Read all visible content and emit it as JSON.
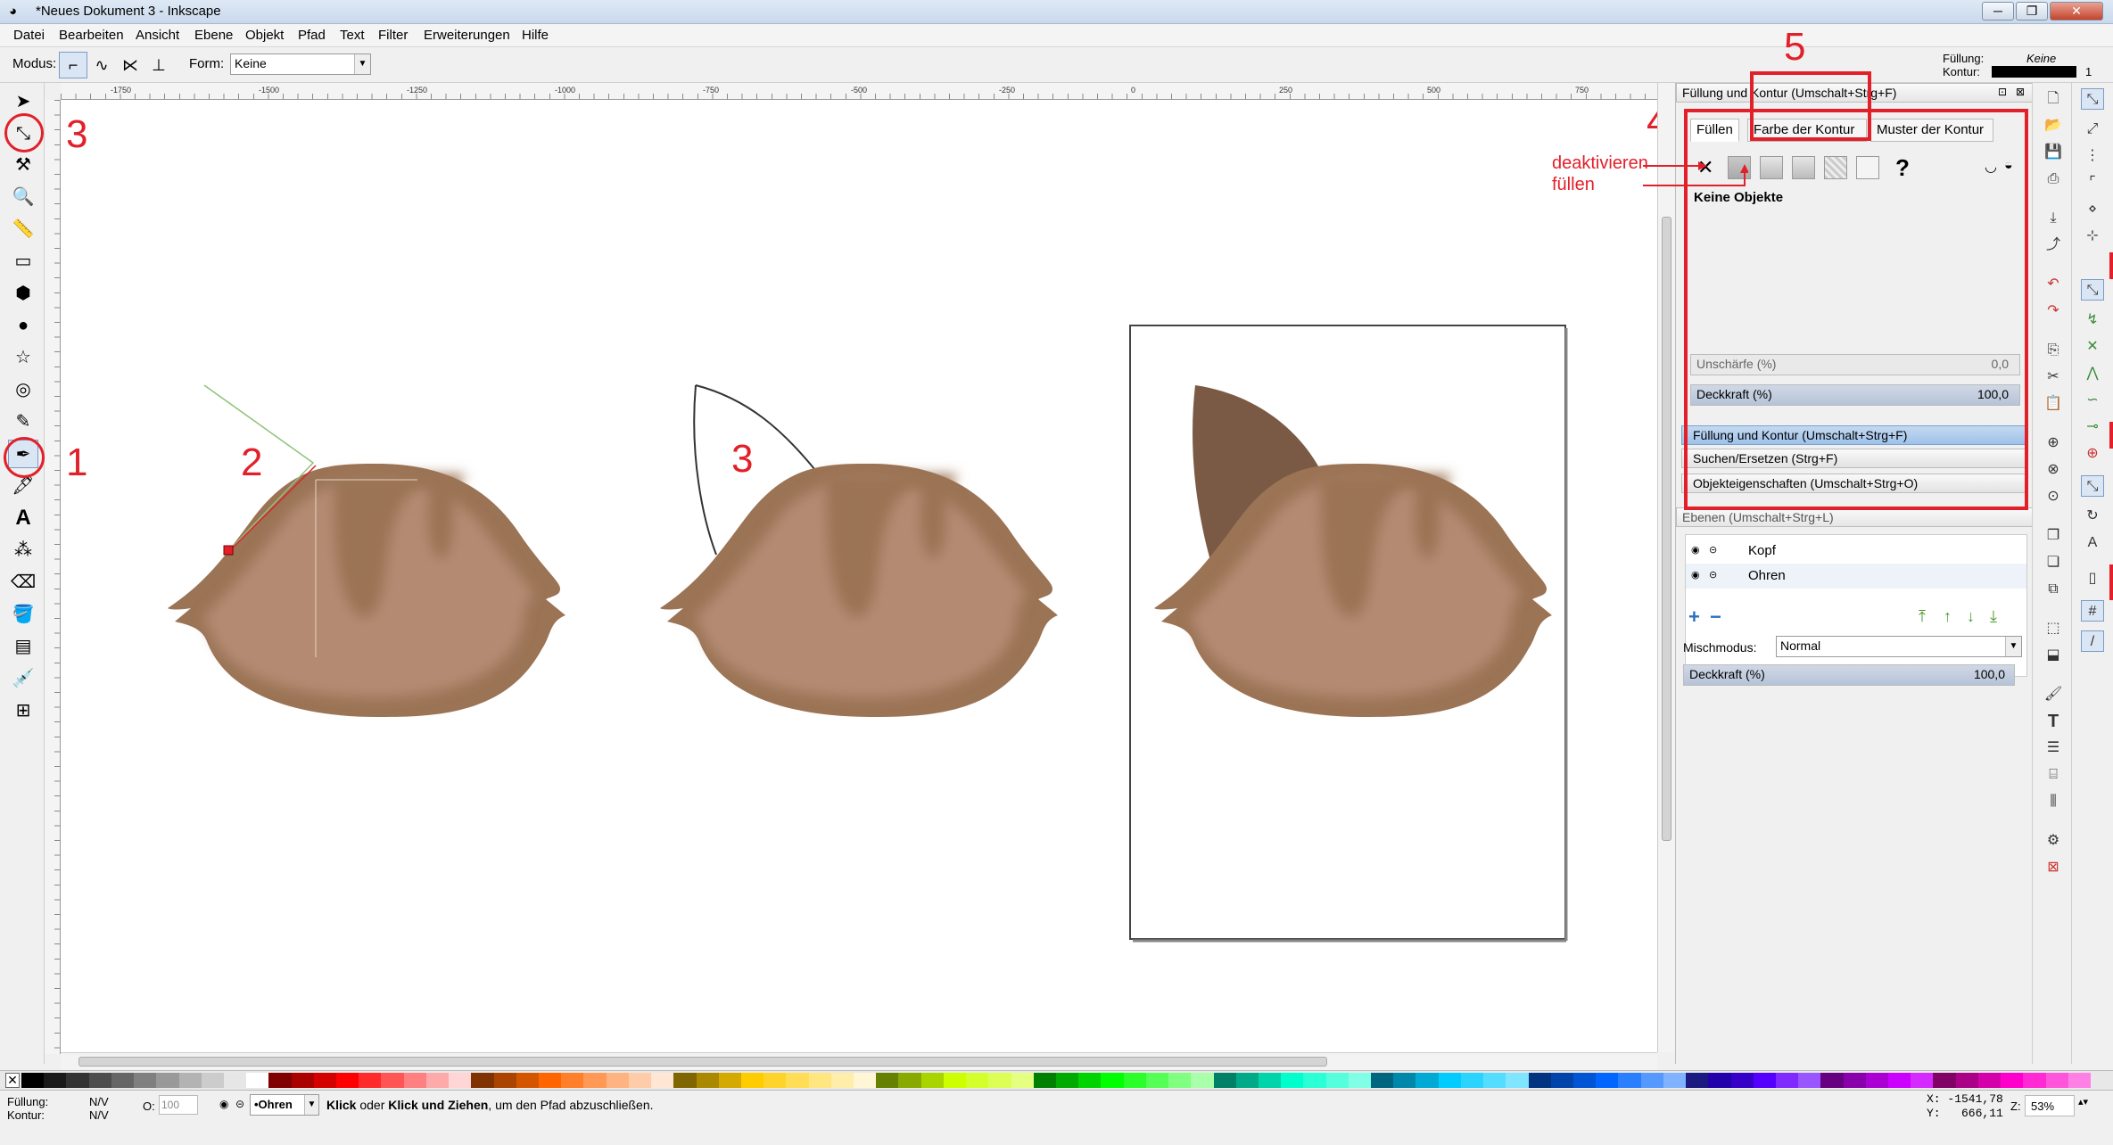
{
  "window": {
    "title": "*Neues Dokument 3 - Inkscape",
    "minimize": "─",
    "maximize": "❐",
    "close": "✕"
  },
  "menu": [
    "Datei",
    "Bearbeiten",
    "Ansicht",
    "Ebene",
    "Objekt",
    "Pfad",
    "Text",
    "Filter",
    "Erweiterungen",
    "Hilfe"
  ],
  "toolctl": {
    "mode_label": "Modus:",
    "form_label": "Form:",
    "form_value": "Keine"
  },
  "style_indicator": {
    "fill_label": "Füllung:",
    "fill_value": "Keine",
    "stroke_label": "Kontur:",
    "stroke_width": "1"
  },
  "ruler_labels": [
    "-1750",
    "-1500",
    "-1250",
    "-1000",
    "-750",
    "-500",
    "-250",
    "0",
    "250",
    "500",
    "750"
  ],
  "annotations": {
    "a1": "1",
    "a2": "2",
    "a3a": "3",
    "a3b": "3",
    "a3c": "3",
    "a4": "4",
    "a5": "5",
    "deact1": "deaktivieren",
    "deact2": "füllen"
  },
  "fill_stroke": {
    "title": "Füllung und Kontur (Umschalt+Strg+F)",
    "tabs": [
      "Füllen",
      "Farbe der Kontur",
      "Muster der Kontur"
    ],
    "x": "✕",
    "question": "?",
    "no_objects": "Keine Objekte",
    "blur_label": "Unschärfe (%)",
    "blur_value": "0,0",
    "opacity_label": "Deckkraft (%)",
    "opacity_value": "100,0"
  },
  "dock_items": [
    "Füllung und Kontur (Umschalt+Strg+F)",
    "Suchen/Ersetzen (Strg+F)",
    "Objekteigenschaften (Umschalt+Strg+O)"
  ],
  "layers": {
    "title": "Ebenen (Umschalt+Strg+L)",
    "items": [
      "Kopf",
      "Ohren"
    ],
    "blend_label": "Mischmodus:",
    "blend_value": "Normal",
    "opacity_label": "Deckkraft (%)",
    "opacity_value": "100,0"
  },
  "status": {
    "fill_label": "Füllung:",
    "fill_value": "N/V",
    "stroke_label": "Kontur:",
    "stroke_value": "N/V",
    "o_label": "O:",
    "o_value": "100",
    "layer": "•Ohren",
    "msg_bold1": "Klick",
    "msg_mid": " oder ",
    "msg_bold2": "Klick und Ziehen",
    "msg_rest": ", um den Pfad abzuschließen.",
    "x": "X: -1541,78",
    "y": "Y:   666,11",
    "z_label": "Z:",
    "zoom": "53%"
  },
  "colors": {
    "ear_dark": "#7a5a44",
    "head_outer": "#9b7355",
    "head_inner": "#b48b72",
    "accent": "#e2202a"
  },
  "palette": [
    "#000000",
    "#1a1a1a",
    "#333333",
    "#4d4d4d",
    "#666666",
    "#808080",
    "#999999",
    "#b3b3b3",
    "#cccccc",
    "#e6e6e6",
    "#ffffff",
    "#800000",
    "#aa0000",
    "#d40000",
    "#ff0000",
    "#ff2a2a",
    "#ff5555",
    "#ff8080",
    "#ffaaaa",
    "#ffd5d5",
    "#803300",
    "#aa4400",
    "#d45500",
    "#ff6600",
    "#ff7f2a",
    "#ff9955",
    "#ffb380",
    "#ffccaa",
    "#ffe6d5",
    "#806600",
    "#aa8800",
    "#d4aa00",
    "#ffcc00",
    "#ffd42a",
    "#ffdd55",
    "#ffe680",
    "#ffeeaa",
    "#fff6d5",
    "#668000",
    "#88aa00",
    "#aad400",
    "#ccff00",
    "#d4ff2a",
    "#ddff55",
    "#e5ff80",
    "#008000",
    "#00aa00",
    "#00d400",
    "#00ff00",
    "#2aff2a",
    "#55ff55",
    "#80ff80",
    "#aaffaa",
    "#008066",
    "#00aa88",
    "#00d4aa",
    "#00ffcc",
    "#2affd5",
    "#55ffdd",
    "#80ffe6",
    "#006680",
    "#0088aa",
    "#00aad4",
    "#00ccff",
    "#2ad4ff",
    "#55ddff",
    "#80e5ff",
    "#003380",
    "#0044aa",
    "#0055d4",
    "#0066ff",
    "#2a7fff",
    "#5599ff",
    "#80b3ff",
    "#1a1a80",
    "#2200aa",
    "#3700c8",
    "#5500ff",
    "#7f2aff",
    "#9955ff",
    "#660080",
    "#8800aa",
    "#aa00d4",
    "#cc00ff",
    "#d42aff",
    "#800066",
    "#aa0088",
    "#d400aa",
    "#ff00cc",
    "#ff2ad4",
    "#ff55dd",
    "#ff80e5"
  ]
}
